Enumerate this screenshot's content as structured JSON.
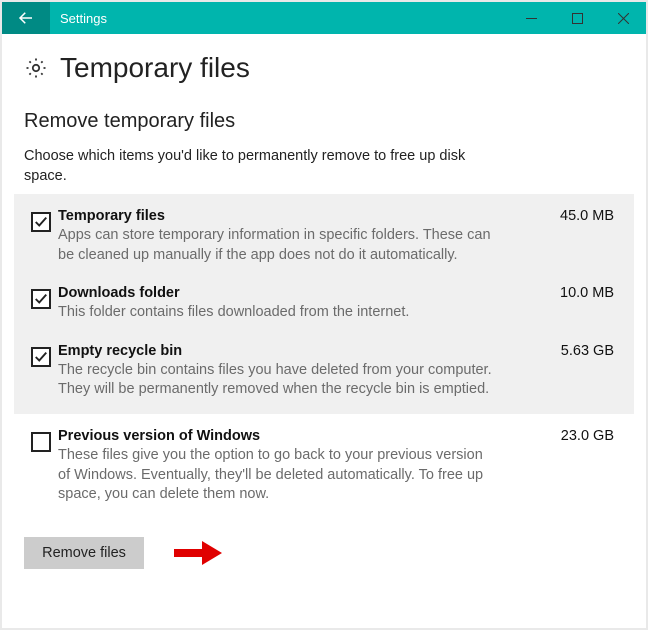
{
  "window": {
    "title": "Settings"
  },
  "page": {
    "title": "Temporary files"
  },
  "section": {
    "title": "Remove temporary files",
    "description": "Choose which items you'd like to permanently remove to free up disk space."
  },
  "items": [
    {
      "title": "Temporary files",
      "size": "45.0 MB",
      "description": "Apps can store temporary information in specific folders. These can be cleaned up manually if the app does not do it automatically.",
      "checked": true
    },
    {
      "title": "Downloads folder",
      "size": "10.0 MB",
      "description": "This folder contains files downloaded from the internet.",
      "checked": true
    },
    {
      "title": "Empty recycle bin",
      "size": "5.63 GB",
      "description": "The recycle bin contains files you have deleted from your computer. They will be permanently removed when the recycle bin is emptied.",
      "checked": true
    },
    {
      "title": "Previous version of Windows",
      "size": "23.0 GB",
      "description": "These files give you the option to go back to your previous version of Windows. Eventually, they'll be deleted automatically. To free up space, you can delete them now.",
      "checked": false
    }
  ],
  "action": {
    "remove_label": "Remove files"
  }
}
